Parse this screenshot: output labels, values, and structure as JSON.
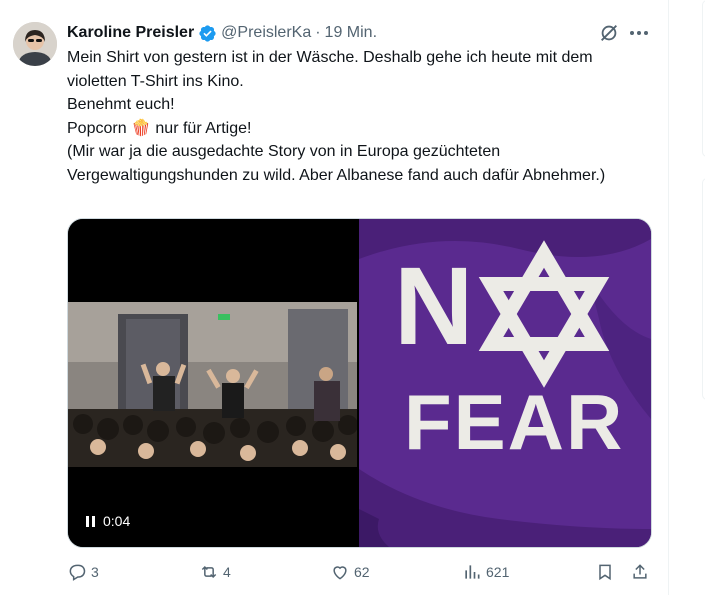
{
  "author": {
    "name": "Karoline Preisler",
    "handle": "@PreislerKa",
    "separator": "·",
    "time": "19 Min."
  },
  "tweet_text": [
    "Mein Shirt von gestern ist in der Wäsche. Deshalb gehe ich heute mit dem violetten T-Shirt ins Kino.",
    "Benehmt euch!",
    "Popcorn 🍿 nur für Artige!",
    "(Mir war ja die ausgedachte Story von in Europa gezüchteten Vergewaltigungshunden zu wild. Aber Albanese fand auch dafür Abnehmer.)"
  ],
  "video": {
    "time": "0:04",
    "state_icon": "pause-icon"
  },
  "photo": {
    "shirt_text_top": "N",
    "shirt_text_bottom": "FEAR",
    "shirt_color": "#5a2a8f"
  },
  "actions": {
    "replies": "3",
    "reposts": "4",
    "likes": "62",
    "views": "621"
  },
  "colors": {
    "text": "#0f1419",
    "secondary": "#536471",
    "verified": "#1d9bf0"
  }
}
